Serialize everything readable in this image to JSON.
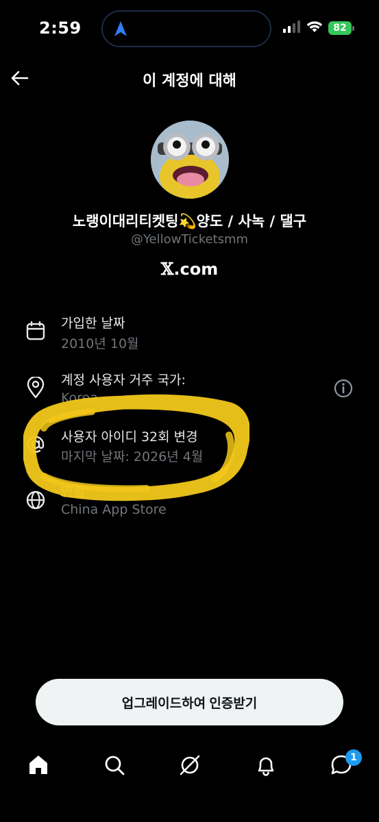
{
  "status_bar": {
    "time": "2:59",
    "battery": "82"
  },
  "header": {
    "title": "이 계정에 대해"
  },
  "profile": {
    "display_name": "노랭이대리티켓팅💫양도 / 사녹 / 댈구",
    "handle": "@YellowTicketsmm",
    "brand_prefix": "𝕏",
    "brand_suffix": ".com"
  },
  "info_rows": {
    "joined": {
      "title": "가입한 날짜",
      "value": "2010년 10월",
      "icon": "calendar-icon"
    },
    "country": {
      "title": "계정 사용자 거주 국가:",
      "value": "Korea",
      "icon": "location-pin-icon"
    },
    "username_changes": {
      "title": "사용자 아이디 32회 변경",
      "value": "마지막 날짜: 2026년 4월",
      "icon": "at-sign-icon"
    },
    "connected_via": {
      "title": "연결",
      "value": "China App Store",
      "icon": "globe-icon"
    }
  },
  "actions": {
    "upgrade_label": "업그레이드하여 인증받기"
  },
  "nav": {
    "messages_badge": "1"
  },
  "colors": {
    "accent": "#1d9bf0",
    "marker": "#f2c81a",
    "battery": "#34c759"
  }
}
